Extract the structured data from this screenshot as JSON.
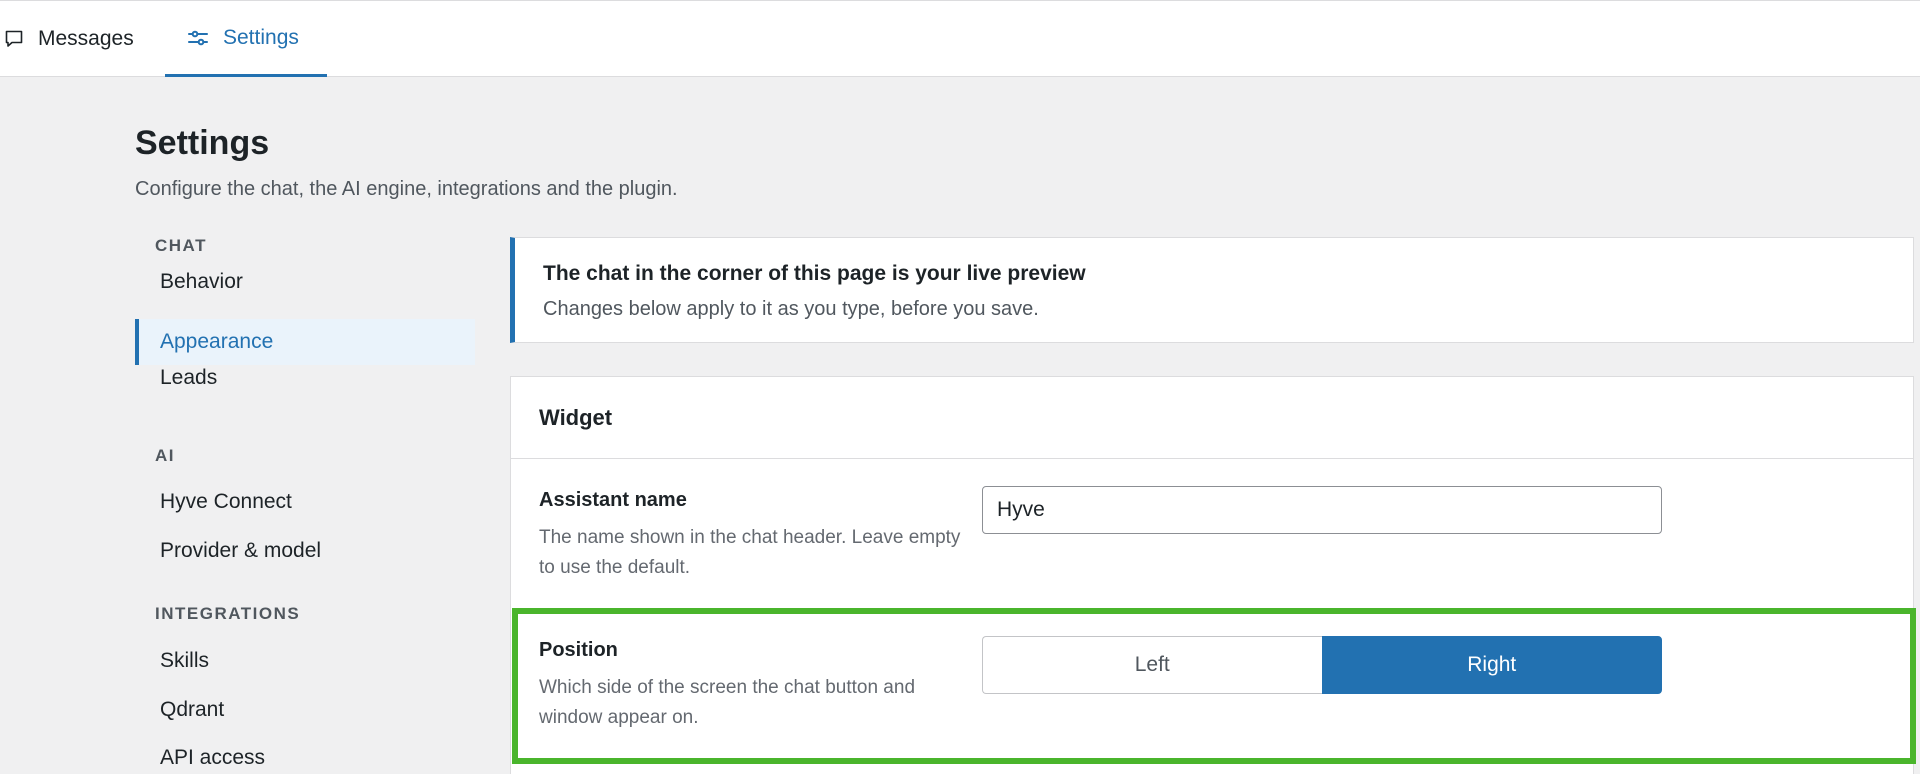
{
  "tabs": {
    "messages_label": "Messages",
    "settings_label": "Settings"
  },
  "page": {
    "title": "Settings",
    "subtitle": "Configure the chat, the AI engine, integrations and the plugin."
  },
  "nav": {
    "chat_label": "CHAT",
    "chat_items": [
      {
        "label": "Behavior"
      },
      {
        "label": "Appearance"
      },
      {
        "label": "Leads"
      }
    ],
    "ai_label": "AI",
    "ai_items": [
      {
        "label": "Hyve Connect"
      },
      {
        "label": "Provider & model"
      }
    ],
    "integrations_label": "INTEGRATIONS",
    "integrations_items": [
      {
        "label": "Skills"
      },
      {
        "label": "Qdrant"
      },
      {
        "label": "API access"
      }
    ]
  },
  "notice": {
    "title": "The chat in the corner of this page is your live preview",
    "text": "Changes below apply to it as you type, before you save."
  },
  "widget": {
    "title": "Widget",
    "assistant_name": {
      "label": "Assistant name",
      "description": "The name shown in the chat header. Leave empty to use the default.",
      "value": "Hyve"
    },
    "position": {
      "label": "Position",
      "description": "Which side of the screen the chat button and window appear on.",
      "options": [
        "Left",
        "Right"
      ],
      "selected": "Right"
    }
  },
  "colors": {
    "accent": "#2271b1",
    "highlight": "#4ab52c",
    "background": "#f0f0f1"
  },
  "icons": {
    "messages": "speech-bubble-icon",
    "settings": "sliders-icon"
  }
}
